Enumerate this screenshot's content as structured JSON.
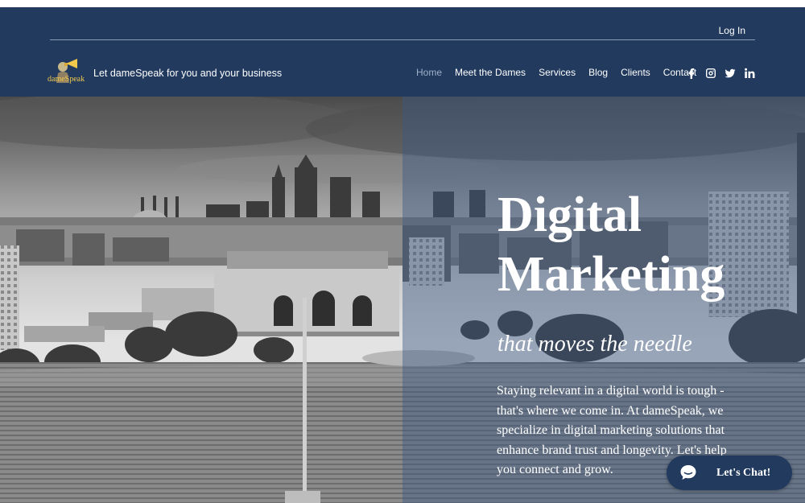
{
  "header": {
    "login_label": "Log In",
    "logo_text": "dameSpeak",
    "tagline": "Let dameSpeak for you and your business",
    "nav": [
      {
        "label": "Home",
        "active": true
      },
      {
        "label": "Meet the Dames"
      },
      {
        "label": "Services"
      },
      {
        "label": "Blog"
      },
      {
        "label": "Clients"
      },
      {
        "label": "Contact"
      }
    ],
    "social": [
      "facebook-icon",
      "instagram-icon",
      "twitter-icon",
      "linkedin-icon"
    ],
    "background_color": "#213a5e"
  },
  "hero": {
    "title_line1": "Digital",
    "title_line2": "Marketing",
    "subtitle": "that moves the needle",
    "body": "Staying relevant in a digital world is tough - that's where we come in. At dameSpeak, we specialize in digital marketing solutions that enhance brand trust and longevity. Let's help you connect and grow."
  },
  "chat": {
    "label": "Let's Chat!",
    "icon": "chat-bubble-icon"
  }
}
